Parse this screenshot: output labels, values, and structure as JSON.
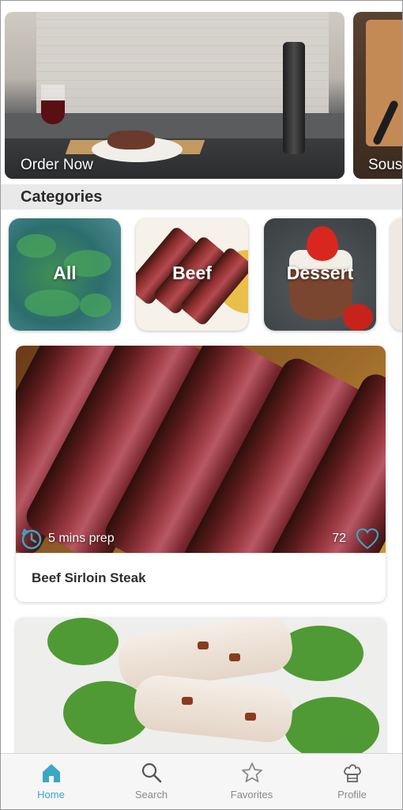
{
  "carousel": {
    "items": [
      {
        "label": "Order Now"
      },
      {
        "label": "Sous"
      }
    ]
  },
  "categories": {
    "title": "Categories",
    "items": [
      {
        "label": "All"
      },
      {
        "label": "Beef"
      },
      {
        "label": "Dessert"
      }
    ]
  },
  "recipes": [
    {
      "title": "Beef Sirloin Steak",
      "prep": "5 mins prep",
      "likes": "72"
    }
  ],
  "tabbar": {
    "items": [
      {
        "label": "Home",
        "icon": "home-icon",
        "active": true
      },
      {
        "label": "Search",
        "icon": "search-icon"
      },
      {
        "label": "Favorites",
        "icon": "star-icon"
      },
      {
        "label": "Profile",
        "icon": "chef-hat-icon"
      }
    ]
  },
  "colors": {
    "accent": "#3aa7c6"
  }
}
